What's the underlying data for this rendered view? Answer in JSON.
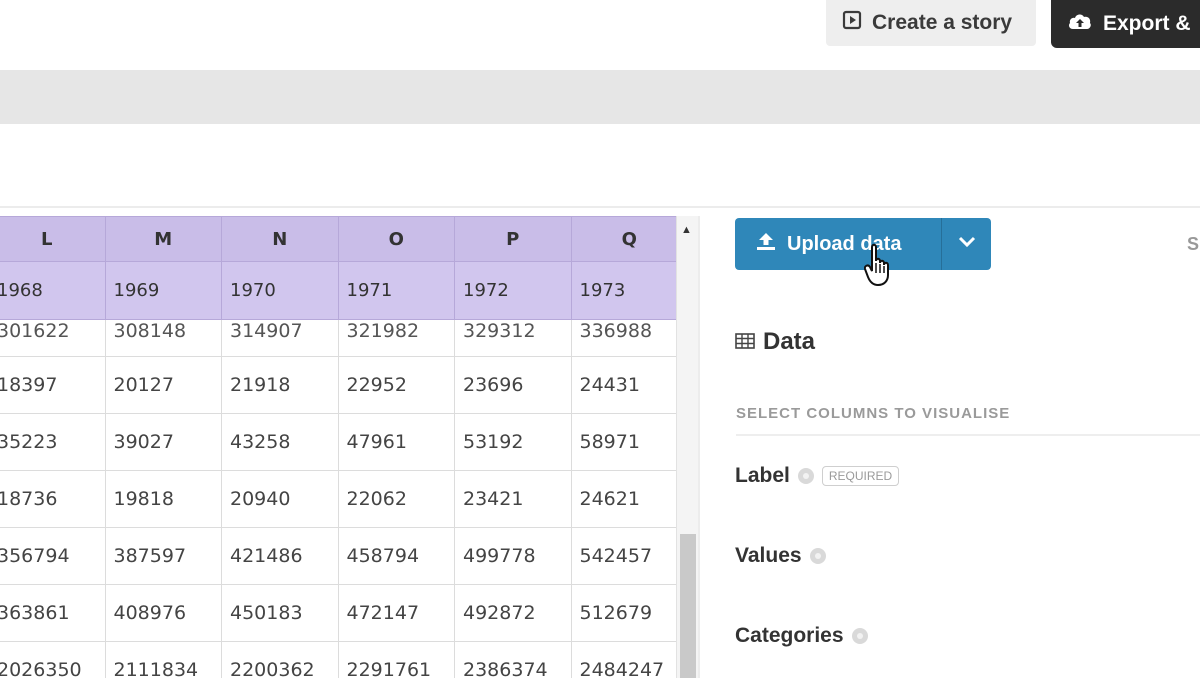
{
  "toolbar": {
    "create_story_label": "Create a story",
    "export_label": "Export &"
  },
  "sheet": {
    "column_headers": [
      "L",
      "M",
      "N",
      "O",
      "P",
      "Q"
    ],
    "year_row": [
      "1968",
      "1969",
      "1970",
      "1971",
      "1972",
      "1973"
    ],
    "rows": [
      [
        "301622",
        "308148",
        "314907",
        "321982",
        "329312",
        "336988"
      ],
      [
        "18397",
        "20127",
        "21918",
        "22952",
        "23696",
        "24431"
      ],
      [
        "35223",
        "39027",
        "43258",
        "47961",
        "53192",
        "58971"
      ],
      [
        "18736",
        "19818",
        "20940",
        "22062",
        "23421",
        "24621"
      ],
      [
        "356794",
        "387597",
        "421486",
        "458794",
        "499778",
        "542457"
      ],
      [
        "363861",
        "408976",
        "450183",
        "472147",
        "492872",
        "512679"
      ],
      [
        "2026350",
        "2111834",
        "2200362",
        "2291761",
        "2386374",
        "2484247"
      ]
    ]
  },
  "panel": {
    "upload_label": "Upload data",
    "side_letter": "S",
    "data_heading": "Data",
    "section_label": "SELECT COLUMNS TO VISUALISE",
    "fields": {
      "label": "Label",
      "required_badge": "REQUIRED",
      "values": "Values",
      "categories": "Categories"
    }
  },
  "icons": {
    "story": "play-square-icon",
    "export": "cloud-upload-icon",
    "upload": "upload-icon",
    "caret": "chevron-down-icon",
    "data": "table-icon"
  },
  "colors": {
    "header_purple": "#c9bde8",
    "upload_blue": "#2f87b9",
    "export_dark": "#2b2b2b"
  }
}
